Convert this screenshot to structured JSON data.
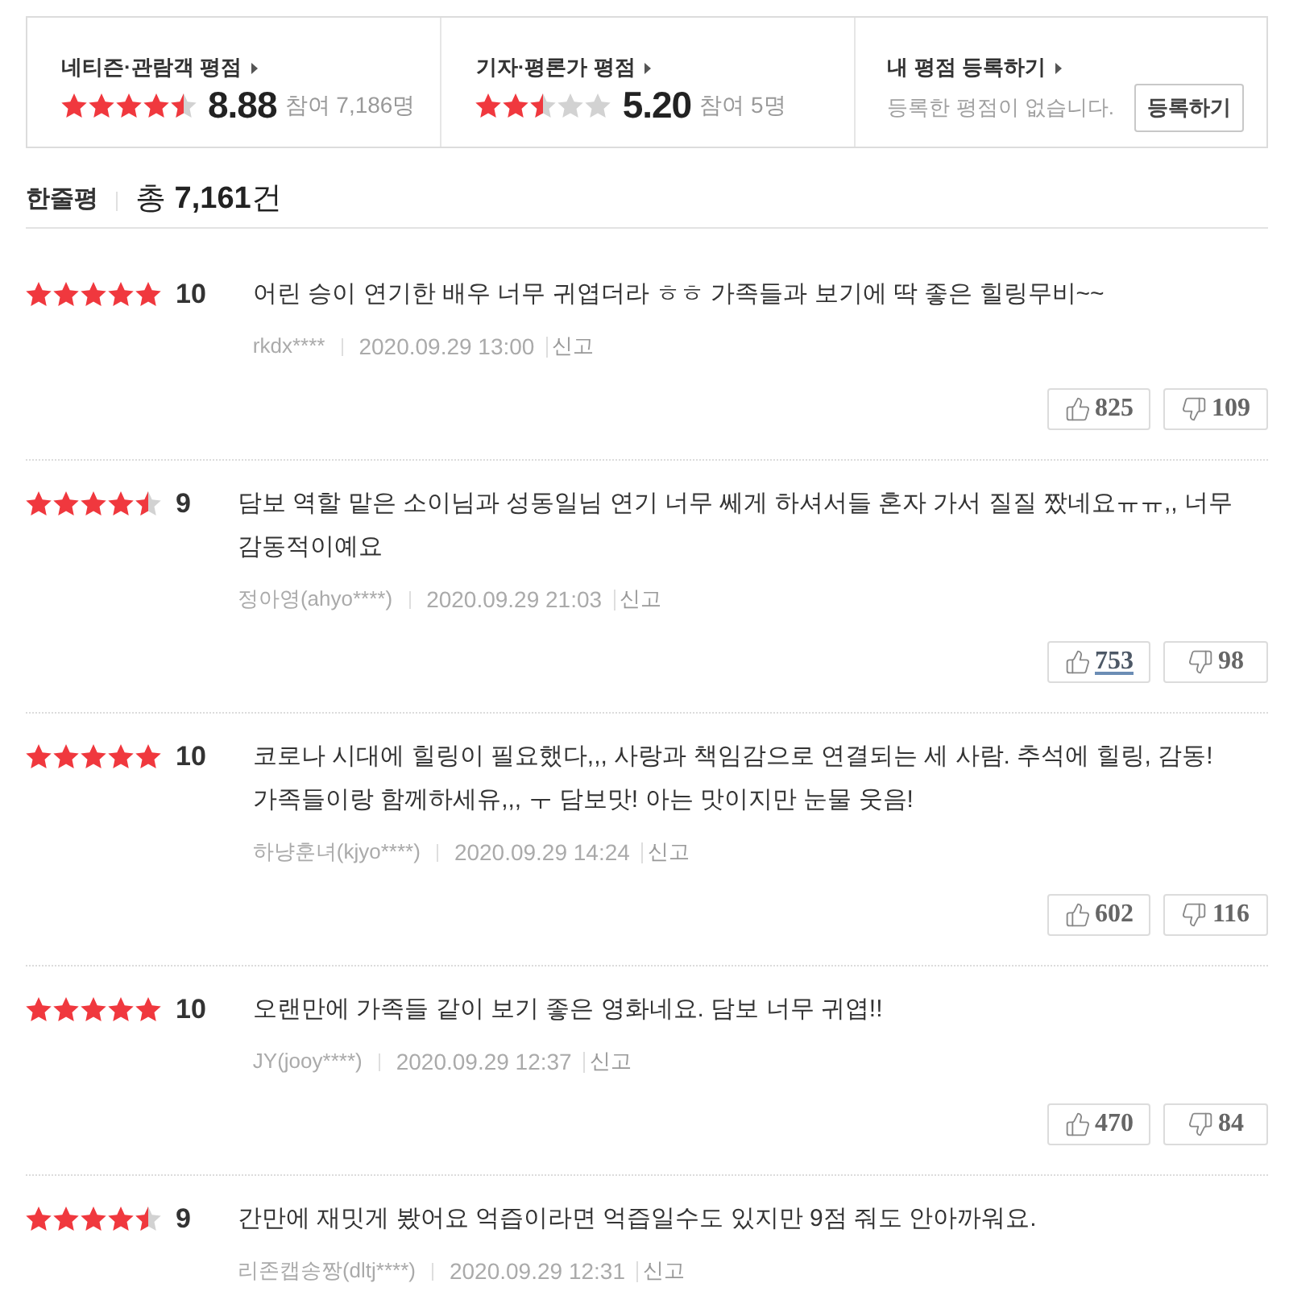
{
  "rating_summary": [
    {
      "kind": "score",
      "title": "네티즌·관람객 평점",
      "stars": 4.5,
      "score": "8.88",
      "participants": "참여 7,186명"
    },
    {
      "kind": "score",
      "title": "기자·평론가 평점",
      "stars": 2.5,
      "score": "5.20",
      "participants": "참여 5명"
    },
    {
      "kind": "register",
      "title": "내 평점 등록하기",
      "message": "등록한 평점이 없습니다.",
      "button": "등록하기"
    }
  ],
  "reviews_header": {
    "title": "한줄평",
    "total": "총 **7,161**건"
  },
  "reviews": [
    {
      "stars": 5,
      "score": "10",
      "text": "어린 승이 연기한 배우 너무 귀엽더라 ㅎㅎ 가족들과 보기에 딱 좋은 힐링무비~~",
      "author": "rkdx****",
      "date": "2020.09.29 13:00",
      "report": "신고",
      "likes": "825",
      "likes_hovered": false,
      "dislikes": "109"
    },
    {
      "stars": 4.5,
      "score": "9",
      "text": "담보 역할 맡은 소이님과 성동일님 연기 너무 쎄게 하셔서들 혼자 가서 질질 짰네요ㅠㅠ,, 너무 감동적이예요",
      "author": "정아영(ahyo****)",
      "date": "2020.09.29 21:03",
      "report": "신고",
      "likes": "753",
      "likes_hovered": true,
      "dislikes": "98"
    },
    {
      "stars": 5,
      "score": "10",
      "text": "코로나 시대에 힐링이 필요했다,,, 사랑과 책임감으로 연결되는 세 사람. 추석에 힐링, 감동! 가족들이랑 함께하세유,,, ㅜ 담보맛! 아는 맛이지만 눈물 웃음!",
      "author": "하냥훈녀(kjyo****)",
      "date": "2020.09.29 14:24",
      "report": "신고",
      "likes": "602",
      "likes_hovered": false,
      "dislikes": "116"
    },
    {
      "stars": 5,
      "score": "10",
      "text": "오랜만에 가족들 같이 보기 좋은 영화네요. 담보 너무 귀엽!!",
      "author": "JY(jooy****)",
      "date": "2020.09.29 12:37",
      "report": "신고",
      "likes": "470",
      "likes_hovered": false,
      "dislikes": "84"
    },
    {
      "stars": 4.5,
      "score": "9",
      "text": "간만에 재밋게 봤어요 억즙이라면 억즙일수도 있지만 9점 줘도 안아까워요.",
      "author": "리존캡송짱(dltj****)",
      "date": "2020.09.29 12:31",
      "report": "신고"
    }
  ]
}
